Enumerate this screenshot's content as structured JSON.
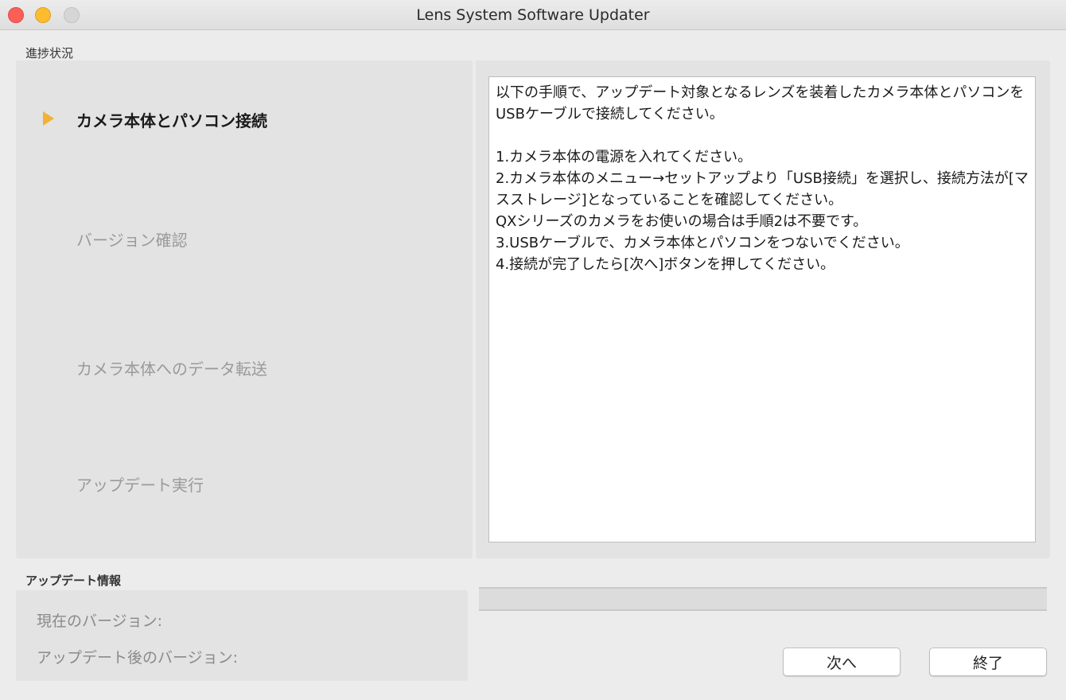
{
  "window": {
    "title": "Lens System Software Updater"
  },
  "progress_section": {
    "label": "進捗状況",
    "steps": [
      {
        "label": "カメラ本体とパソコン接続",
        "state": "active"
      },
      {
        "label": "バージョン確認",
        "state": "inactive"
      },
      {
        "label": "カメラ本体へのデータ転送",
        "state": "inactive"
      },
      {
        "label": "アップデート実行",
        "state": "inactive"
      }
    ]
  },
  "instructions": {
    "text": "以下の手順で、アップデート対象となるレンズを装着したカメラ本体とパソコンをUSBケーブルで接続してください。\n\n1.カメラ本体の電源を入れてください。\n2.カメラ本体のメニュー→セットアップより「USB接続」を選択し、接続方法が[マスストレージ]となっていることを確認してください。\nQXシリーズのカメラをお使いの場合は手順2は不要です。\n3.USBケーブルで、カメラ本体とパソコンをつないでください。\n4.接続が完了したら[次へ]ボタンを押してください。"
  },
  "update_info": {
    "label": "アップデート情報",
    "current_version_label": "現在のバージョン:",
    "after_version_label": "アップデート後のバージョン:"
  },
  "progress_bar": {
    "value": 0
  },
  "buttons": {
    "next_label": "次へ",
    "exit_label": "終了"
  },
  "colors": {
    "active_marker": "#f2b238",
    "close": "#fc5f57",
    "minimize": "#fdbc2e"
  }
}
